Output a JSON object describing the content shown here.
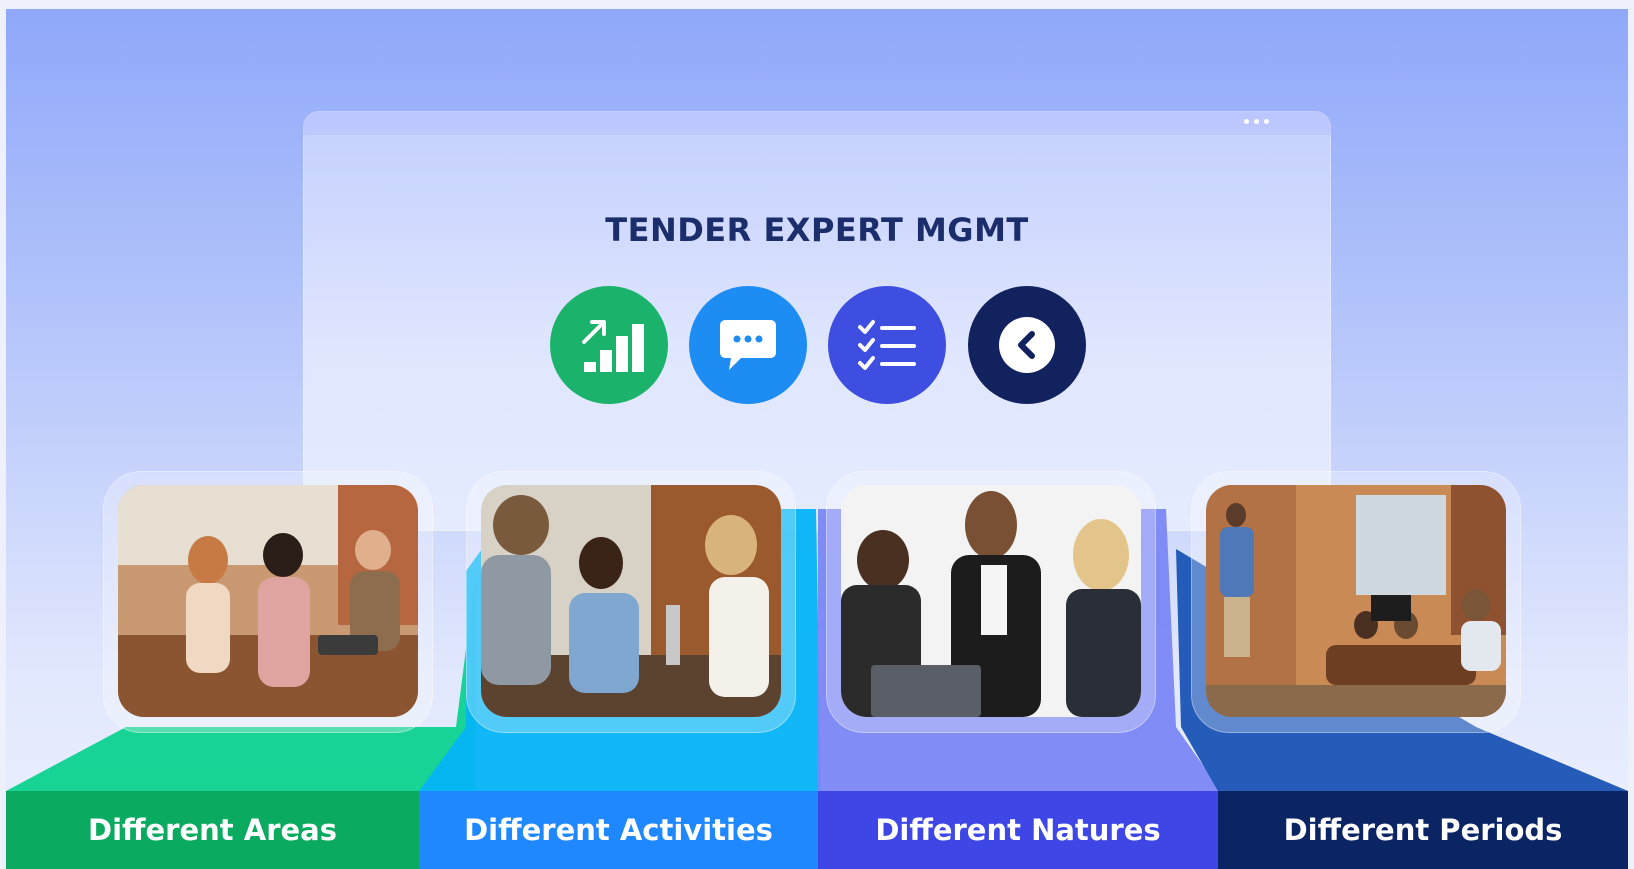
{
  "panel": {
    "title": "TENDER EXPERT MGMT",
    "menu_icon": "more-horizontal-icon"
  },
  "features": [
    {
      "icon": "growth-chart-icon",
      "color": "#1bb36b"
    },
    {
      "icon": "chat-bubble-icon",
      "color": "#1d8cf3"
    },
    {
      "icon": "checklist-icon",
      "color": "#3d4ee0"
    },
    {
      "icon": "back-arrow-icon",
      "color": "#12225e"
    }
  ],
  "photos": [
    {
      "subject": "team-meeting-photo"
    },
    {
      "subject": "students-laughing-photo"
    },
    {
      "subject": "businesswomen-laptop-photo"
    },
    {
      "subject": "presentation-room-photo"
    }
  ],
  "categories": [
    {
      "label": "Different Areas",
      "color": "#0aaa60"
    },
    {
      "label": "Different Activities",
      "color": "#1f88ff"
    },
    {
      "label": "Different Natures",
      "color": "#3e46e6"
    },
    {
      "label": "Different Periods",
      "color": "#0b2464"
    }
  ]
}
